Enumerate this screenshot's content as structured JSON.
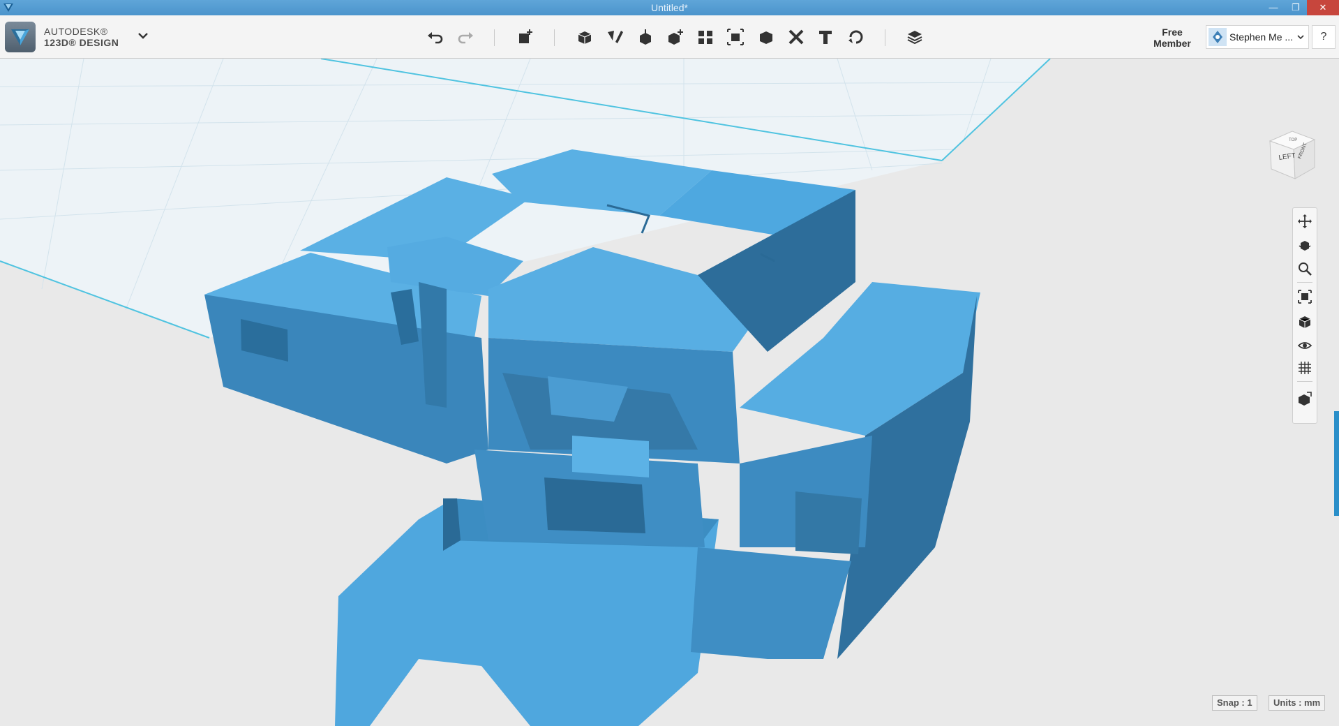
{
  "window": {
    "title": "Untitled*"
  },
  "brand": {
    "line1": "AUTODESK®",
    "line2": "123D® DESIGN"
  },
  "account": {
    "member_line1": "Free",
    "member_line2": "Member",
    "user_name": "Stephen Me ...",
    "help_label": "?"
  },
  "status": {
    "snap": "Snap : 1",
    "units": "Units : mm"
  },
  "viewcube": {
    "face_left": "LEFT",
    "face_front": "FRONT",
    "face_top": "TOP"
  },
  "colors": {
    "title_bar": "#4b94cc",
    "model": "#4a9fd8",
    "grid": "#4fc3e0",
    "close_button": "#c7463d"
  },
  "toolbar_icons": [
    "undo-icon",
    "redo-icon",
    "transform-icon",
    "primitives-icon",
    "sketch-icon",
    "construct-icon",
    "modify-icon",
    "pattern-icon",
    "group-icon",
    "combine-icon",
    "measure-icon",
    "text-icon",
    "snap-icon",
    "material-icon"
  ],
  "nav_icons": [
    "pan-icon",
    "orbit-icon",
    "zoom-icon",
    "fit-icon",
    "view-cube-icon",
    "visibility-icon",
    "grid-icon",
    "material-view-icon"
  ]
}
